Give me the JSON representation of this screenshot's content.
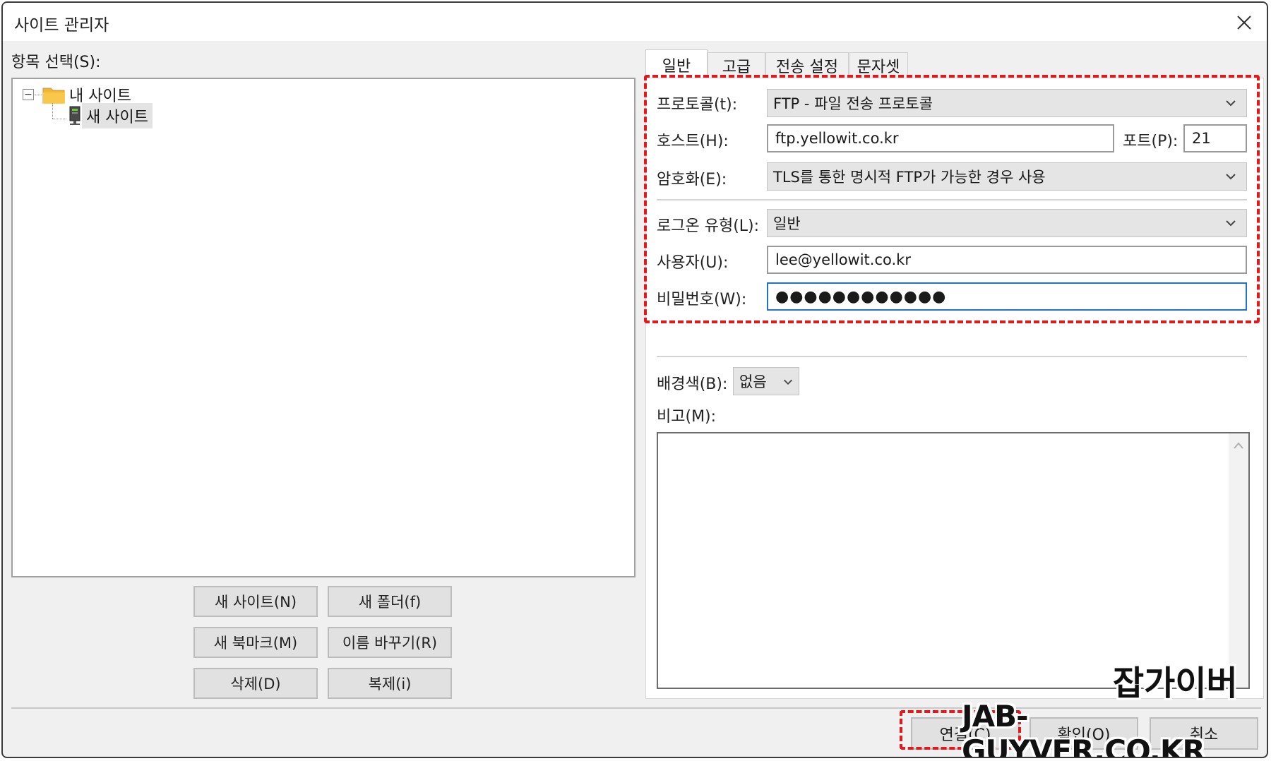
{
  "window": {
    "title": "사이트 관리자"
  },
  "left": {
    "label": "항목 선택(S):",
    "tree": [
      {
        "label": "내 사이트",
        "icon": "folder-icon"
      },
      {
        "label": "새 사이트",
        "icon": "server-icon",
        "selected": true
      }
    ],
    "buttons": {
      "new_site": "새 사이트(N)",
      "new_folder": "새 폴더(f)",
      "new_bookmark": "새 북마크(M)",
      "rename": "이름 바꾸기(R)",
      "delete": "삭제(D)",
      "duplicate": "복제(i)"
    }
  },
  "tabs": [
    "일반",
    "고급",
    "전송 설정",
    "문자셋"
  ],
  "general": {
    "protocol_label": "프로토콜(t):",
    "protocol_value": "FTP - 파일 전송 프로토콜",
    "host_label": "호스트(H):",
    "host_value": "ftp.yellowit.co.kr",
    "port_label": "포트(P):",
    "port_value": "21",
    "encryption_label": "암호화(E):",
    "encryption_value": "TLS를 통한 명시적 FTP가 가능한 경우 사용",
    "logon_label": "로그온 유형(L):",
    "logon_value": "일반",
    "user_label": "사용자(U):",
    "user_value": "lee@yellowit.co.kr",
    "password_label": "비밀번호(W):",
    "password_value": "●●●●●●●●●●●●",
    "bgcolor_label": "배경색(B):",
    "bgcolor_value": "없음",
    "memo_label": "비고(M):"
  },
  "footer": {
    "connect": "연결(C)",
    "ok": "확인(O)",
    "cancel": "취소"
  },
  "watermark": {
    "korean": "잡가이버",
    "english": "JAB-GUYVER.CO.KR"
  },
  "colors": {
    "highlight_dash": "#e3181b",
    "focus_border": "#1f74c9",
    "folder": "#f2b632"
  }
}
